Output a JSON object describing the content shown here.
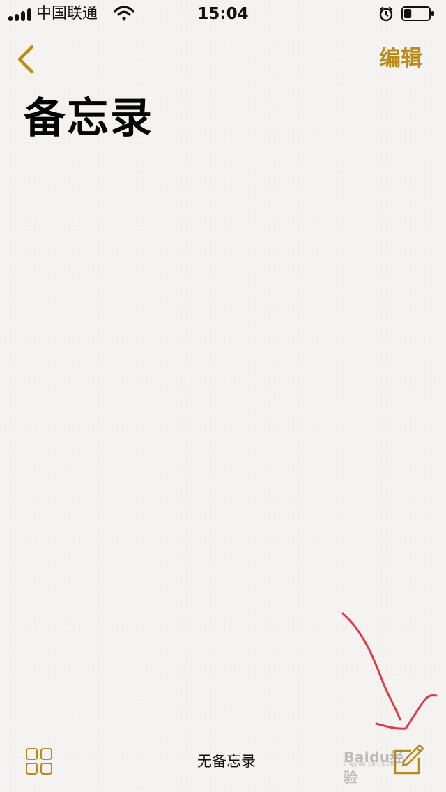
{
  "status_bar": {
    "carrier": "中国联通",
    "time": "15:04",
    "signal_icon": "signal-bars-icon",
    "wifi_icon": "wifi-icon",
    "alarm_icon": "alarm-clock-icon",
    "battery_icon": "battery-icon",
    "battery_level": 0.3
  },
  "nav": {
    "back_icon": "chevron-left-icon",
    "edit_label": "编辑"
  },
  "page": {
    "title": "备忘录"
  },
  "toolbar": {
    "gallery_icon": "grid-icon",
    "status_text": "无备忘录",
    "compose_icon": "compose-note-icon"
  },
  "watermark": {
    "text": "Baidu经验",
    "subtext": "jingyan.baidu.com"
  },
  "colors": {
    "accent": "#b98b18",
    "background": "#f4f3f1",
    "annotation": "#e03a46"
  }
}
